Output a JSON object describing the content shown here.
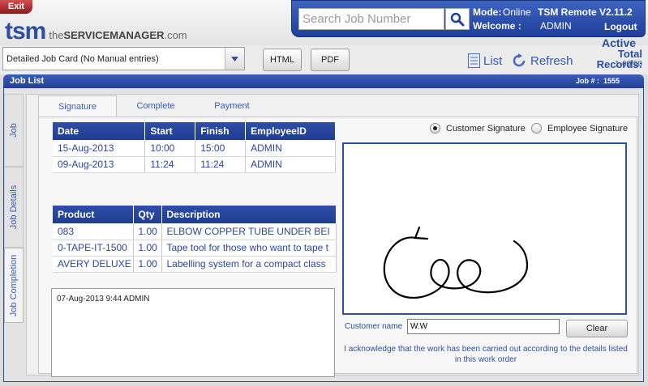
{
  "header": {
    "exit_label": "Exit",
    "logo_mark": "tsm",
    "logo_text_plain": "the",
    "logo_text_bold": "SERVICEMANAGER",
    "logo_text_suffix": ".com",
    "search_placeholder": "Search Job Number",
    "mode_label": "Mode:",
    "mode_value": "Online",
    "app_version": "TSM Remote V2.11.2",
    "welcome_label": "Welcome :",
    "user": "ADMIN",
    "logout_label": "Logout"
  },
  "toolbar": {
    "template_selected": "Detailed Job Card (No Manual entries)",
    "html_label": "HTML",
    "pdf_label": "PDF",
    "list_label": "List",
    "refresh_label": "Refresh",
    "status": "Active",
    "records_label": "Total Records:",
    "records_value": "1-60/60"
  },
  "job_list": {
    "title": "Job List",
    "job_number_label": "Job # :",
    "job_number": "1555"
  },
  "side_tabs": [
    {
      "label": "Job"
    },
    {
      "label": "Job Details"
    },
    {
      "label": "Job Completion"
    }
  ],
  "tabs": [
    {
      "label": "Signature"
    },
    {
      "label": "Complete"
    },
    {
      "label": "Payment"
    }
  ],
  "time_table": {
    "headers": [
      "Date",
      "Start",
      "Finish",
      "EmployeeID"
    ],
    "rows": [
      [
        "15-Aug-2013",
        "10:00",
        "15:00",
        "ADMIN"
      ],
      [
        "09-Aug-2013",
        "11:24",
        "11:24",
        "ADMIN"
      ]
    ]
  },
  "product_table": {
    "headers": [
      "Product",
      "Qty",
      "Description"
    ],
    "rows": [
      [
        "083",
        "1.00",
        "ELBOW COPPER TUBE UNDER BEI"
      ],
      [
        "0-TAPE-IT-1500",
        "1.00",
        "Tape tool for those who want to tape t"
      ],
      [
        "AVERY DELUXE",
        "1.00",
        "Labelling system for a compact class"
      ]
    ]
  },
  "notes_text": "07-Aug-2013 9:44 ADMIN",
  "signature": {
    "option_customer": "Customer Signature",
    "option_employee": "Employee Signature",
    "selected": "customer",
    "customer_name_label": "Customer name",
    "customer_name_value": "W.W",
    "clear_label": "Clear",
    "acknowledgement": "I acknowledge that the work has been carried out according to the details listed in this work order"
  }
}
